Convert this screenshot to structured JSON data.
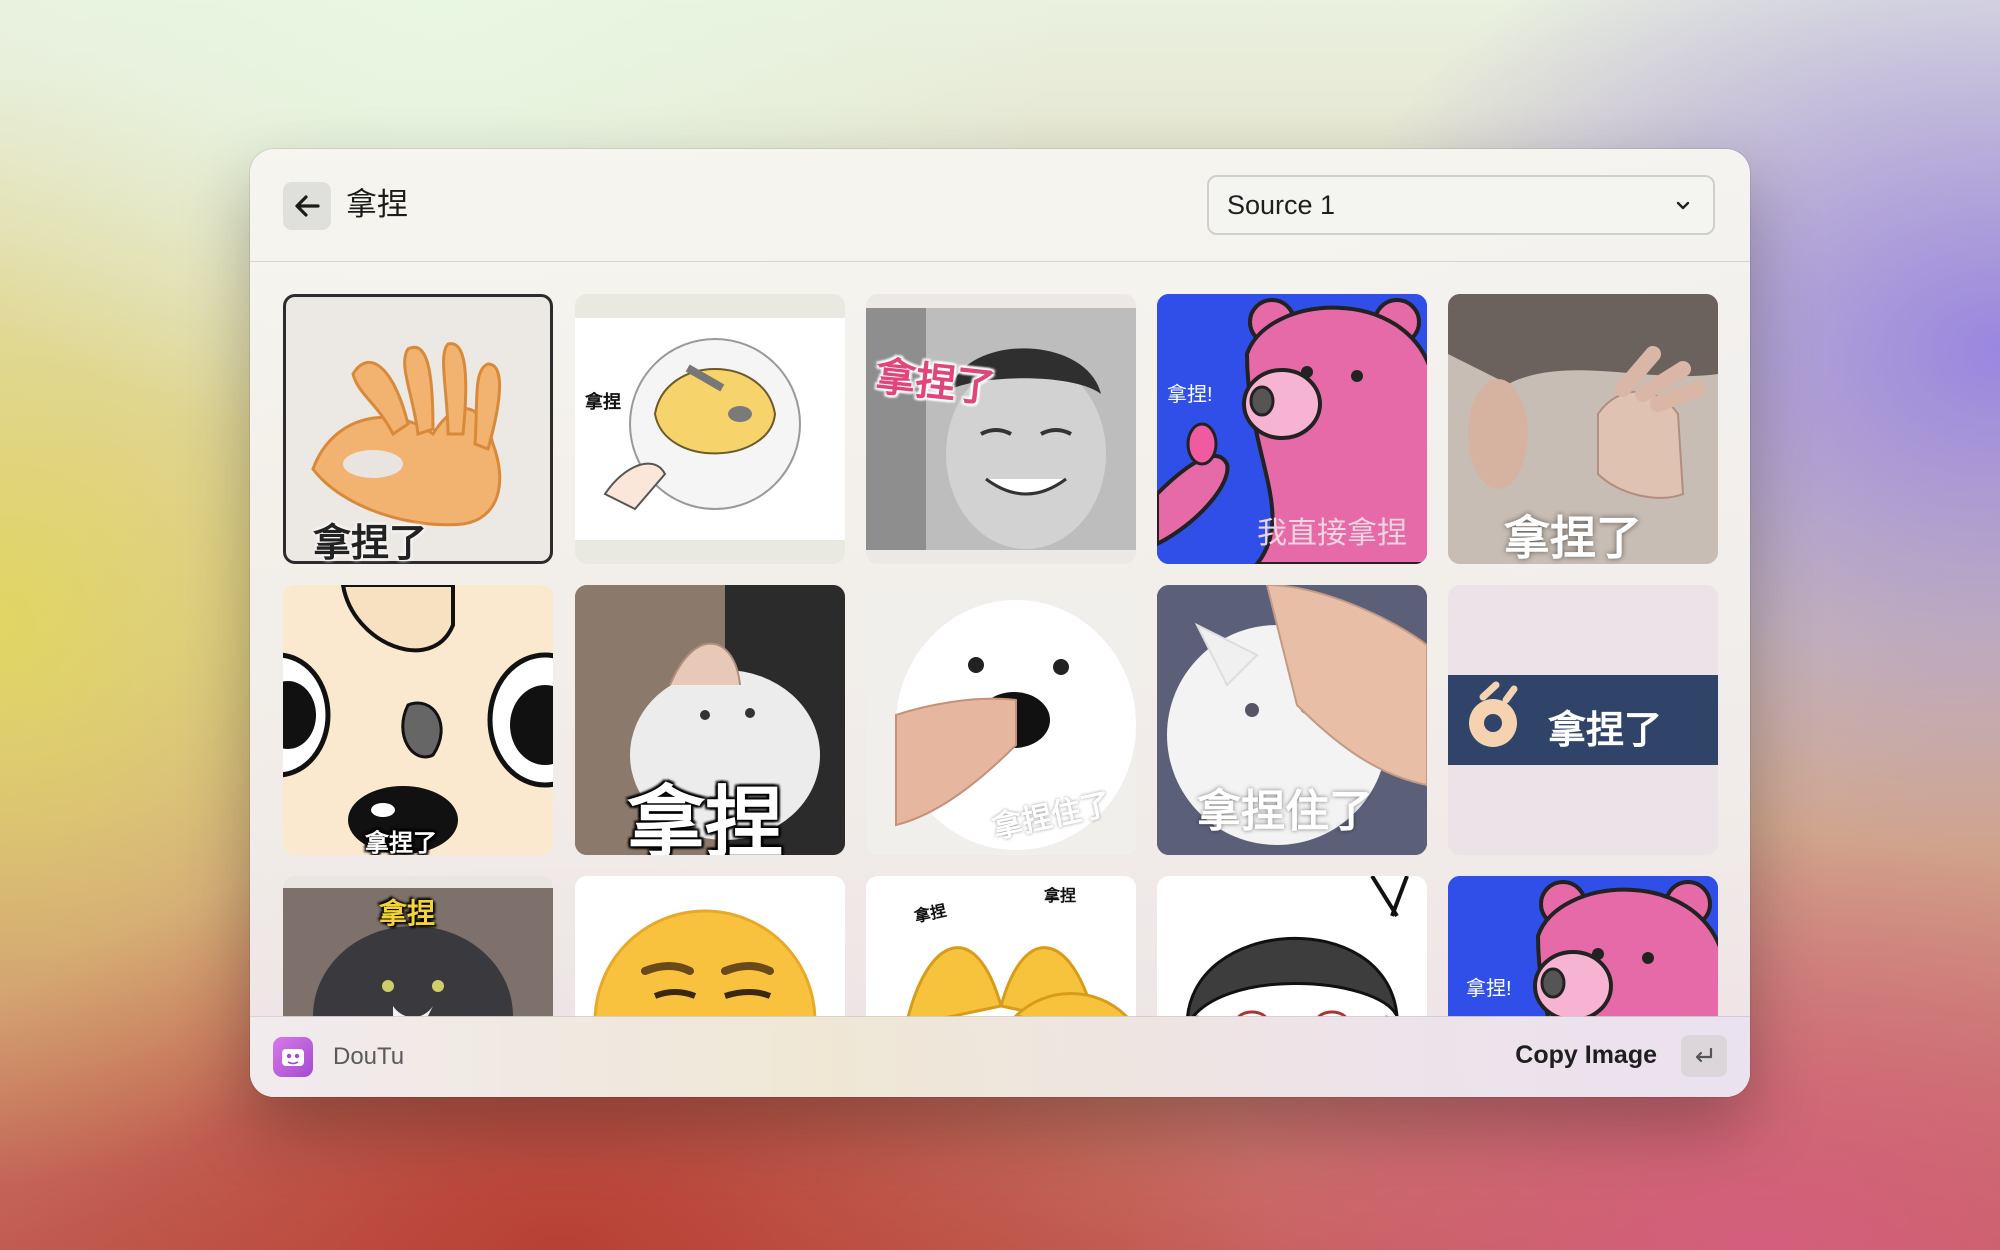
{
  "header": {
    "title": "拿捏",
    "source_select": {
      "value": "Source 1"
    }
  },
  "grid": {
    "items": [
      {
        "caption": "拿捏了"
      },
      {
        "caption": "拿捏"
      },
      {
        "caption": "拿捏了"
      },
      {
        "caption": "拿捏!",
        "caption2": "我直接拿捏"
      },
      {
        "caption": "拿捏了"
      },
      {
        "caption": "拿捏了"
      },
      {
        "caption": "拿捏"
      },
      {
        "caption": "拿捏住了"
      },
      {
        "caption": "拿捏住了"
      },
      {
        "caption": "拿捏了"
      },
      {
        "caption": "拿捏"
      },
      {
        "caption": ""
      },
      {
        "caption": "拿捏",
        "caption2": "拿捏"
      },
      {
        "caption": ""
      },
      {
        "caption": "拿捏!"
      }
    ]
  },
  "footer": {
    "app_name": "DouTu",
    "action_label": "Copy Image"
  },
  "colors": {
    "selection_border": "#2c2c2c",
    "bear_blue": "#2f4fe8",
    "bear_pink": "#e76aa8",
    "banner_navy": "#2f4468"
  }
}
